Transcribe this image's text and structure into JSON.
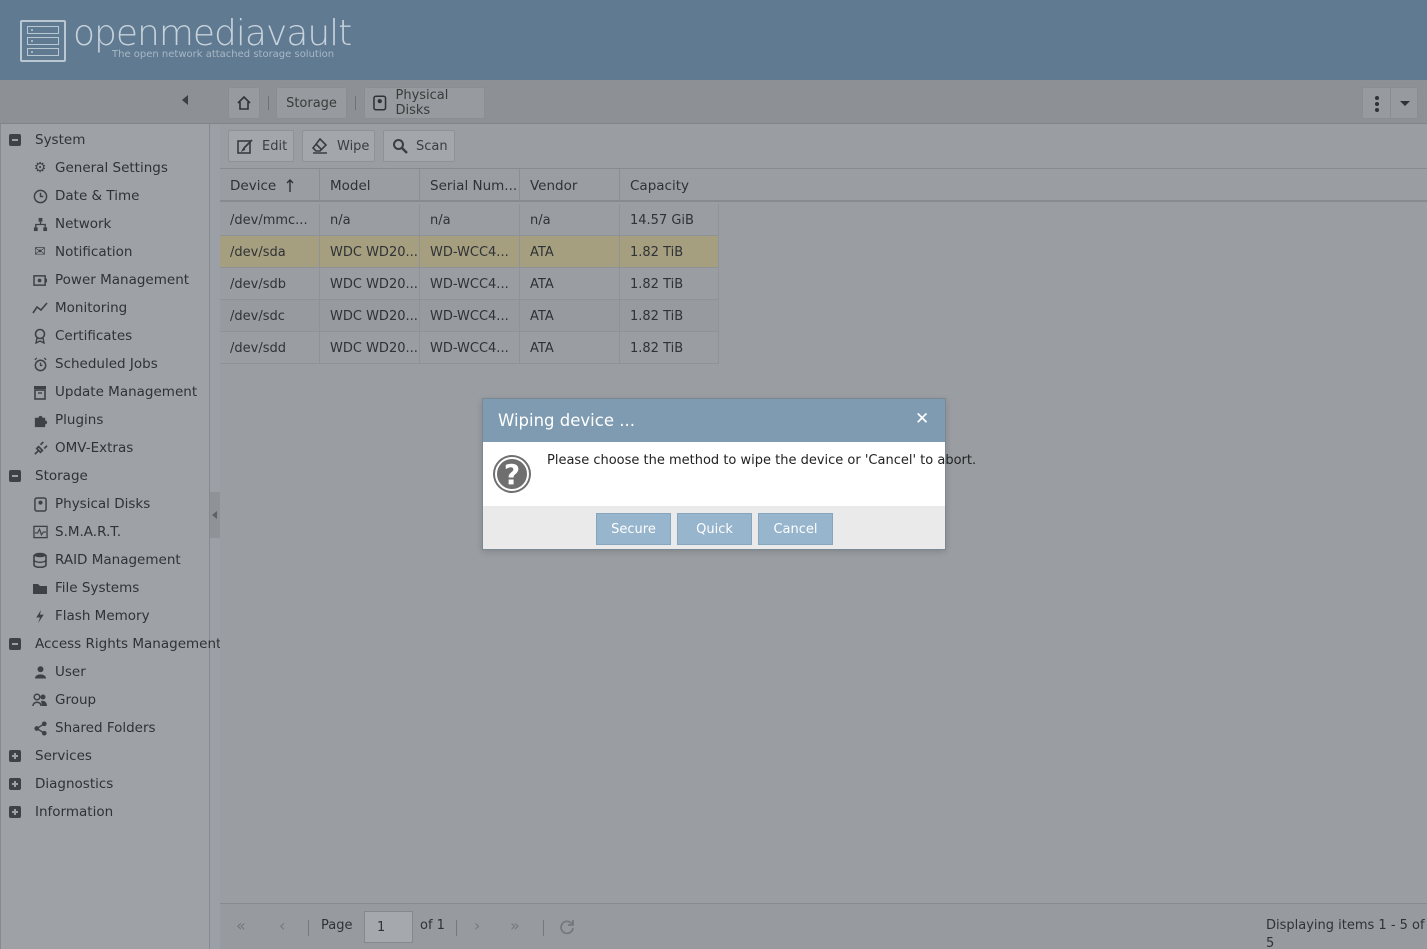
{
  "app": {
    "name": "openmediavault",
    "tagline": "The open network attached storage solution"
  },
  "breadcrumb": {
    "storage": "Storage",
    "current": "Physical Disks"
  },
  "sidebar": {
    "groups": [
      {
        "label": "System",
        "expanded": true,
        "items": [
          {
            "label": "General Settings",
            "icon": "gears-icon"
          },
          {
            "label": "Date & Time",
            "icon": "clock-icon"
          },
          {
            "label": "Network",
            "icon": "network-icon"
          },
          {
            "label": "Notification",
            "icon": "envelope-icon"
          },
          {
            "label": "Power Management",
            "icon": "power-icon"
          },
          {
            "label": "Monitoring",
            "icon": "line-chart-icon"
          },
          {
            "label": "Certificates",
            "icon": "certificate-icon"
          },
          {
            "label": "Scheduled Jobs",
            "icon": "alarm-clock-icon"
          },
          {
            "label": "Update Management",
            "icon": "archive-box-icon"
          },
          {
            "label": "Plugins",
            "icon": "puzzle-icon"
          },
          {
            "label": "OMV-Extras",
            "icon": "plug-icon"
          }
        ]
      },
      {
        "label": "Storage",
        "expanded": true,
        "items": [
          {
            "label": "Physical Disks",
            "icon": "hdd-icon"
          },
          {
            "label": "S.M.A.R.T.",
            "icon": "heartbeat-icon"
          },
          {
            "label": "RAID Management",
            "icon": "database-icon"
          },
          {
            "label": "File Systems",
            "icon": "folder-icon"
          },
          {
            "label": "Flash Memory",
            "icon": "flash-icon"
          }
        ]
      },
      {
        "label": "Access Rights Management",
        "expanded": true,
        "items": [
          {
            "label": "User",
            "icon": "user-icon"
          },
          {
            "label": "Group",
            "icon": "users-icon"
          },
          {
            "label": "Shared Folders",
            "icon": "share-icon"
          }
        ]
      },
      {
        "label": "Services",
        "expanded": false,
        "items": []
      },
      {
        "label": "Diagnostics",
        "expanded": false,
        "items": []
      },
      {
        "label": "Information",
        "expanded": false,
        "items": []
      }
    ]
  },
  "toolbar": {
    "edit": "Edit",
    "wipe": "Wipe",
    "scan": "Scan"
  },
  "grid": {
    "columns": [
      "Device",
      "Model",
      "Serial Num...",
      "Vendor",
      "Capacity"
    ],
    "sort_column": "Device",
    "rows": [
      [
        "/dev/mmc...",
        "n/a",
        "n/a",
        "n/a",
        "14.57 GiB"
      ],
      [
        "/dev/sda",
        "WDC WD20...",
        "WD-WCC4...",
        "ATA",
        "1.82 TiB"
      ],
      [
        "/dev/sdb",
        "WDC WD20...",
        "WD-WCC4...",
        "ATA",
        "1.82 TiB"
      ],
      [
        "/dev/sdc",
        "WDC WD20...",
        "WD-WCC4...",
        "ATA",
        "1.82 TiB"
      ],
      [
        "/dev/sdd",
        "WDC WD20...",
        "WD-WCC4...",
        "ATA",
        "1.82 TiB"
      ]
    ],
    "selected_row": 1
  },
  "pager": {
    "page_label": "Page",
    "page_value": "1",
    "of_label": "of 1",
    "display_text": "Displaying items 1 - 5 of 5"
  },
  "dialog": {
    "title": "Wiping device ...",
    "message": "Please choose the method to wipe the device or 'Cancel' to abort.",
    "buttons": {
      "secure": "Secure",
      "quick": "Quick",
      "cancel": "Cancel"
    }
  },
  "colors": {
    "header_bg": "#607a91",
    "dialog_header": "#7f9bb1",
    "dialog_button": "#97b5cd",
    "selected_row": "#a69f7f"
  }
}
